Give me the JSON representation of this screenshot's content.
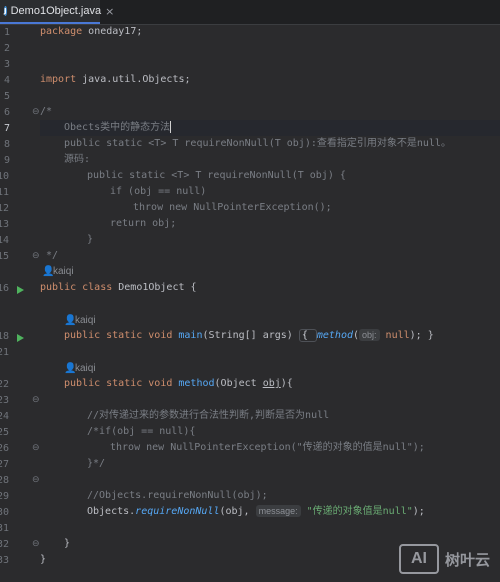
{
  "tab": {
    "icon": "java-file-icon",
    "icon_letter": "J",
    "label": "Demo1Object.java",
    "close": "×"
  },
  "line_numbers": [
    "1",
    "2",
    "3",
    "4",
    "5",
    "6",
    "7",
    "8",
    "9",
    "10",
    "11",
    "12",
    "13",
    "14",
    "15",
    "",
    "16",
    "",
    "18",
    "21",
    "",
    "22",
    "23",
    "24",
    "25",
    "26",
    "27",
    "28",
    "29",
    "30",
    "31",
    "32",
    "33"
  ],
  "authors": [
    "kaiqi",
    "kaiqi",
    "kaiqi"
  ],
  "code": {
    "l1a": "package",
    "l1b": " oneday17;",
    "l4a": "import",
    "l4b": " java.util.Objects;",
    "l6": "/*",
    "l7": "Obects类中的静态方法",
    "l8": "public static <T> T requireNonNull(T obj):查看指定引用对象不是null。",
    "l9": "源码:",
    "l10": "public static <T> T requireNonNull(T obj) {",
    "l11": "if (obj == null)",
    "l12": "throw new NullPointerException();",
    "l13": "return obj;",
    "l14": "}",
    "l15": "*/",
    "l16a": "public class",
    "l16b": " Demo1Object {",
    "l18a": "public static void",
    "l18b": " main",
    "l18c": "(String[] args) ",
    "l18d": "{ ",
    "l18e": "method",
    "l18f": "(",
    "l18hint": "obj:",
    "l18g": " null",
    "l18h": "); }",
    "l22a": "public static void",
    "l22b": " method",
    "l22c": "(Object ",
    "l22d": "obj",
    "l22e": "){",
    "l24": "//对传递过来的参数进行合法性判断,判断是否为null",
    "l25": "/*if(obj == null){",
    "l26": "throw new NullPointerException(\"传递的对象的值是null\");",
    "l27": "}*/",
    "l29": "//Objects.requireNonNull(obj);",
    "l30a": "Objects.",
    "l30b": "requireNonNull",
    "l30c": "(obj, ",
    "l30hint": "message:",
    "l30d": " \"传递的对象值是null\"",
    "l30e": ");",
    "l32": "}",
    "l33": "}"
  },
  "watermark": {
    "logo": "AI",
    "text": "树叶云"
  }
}
